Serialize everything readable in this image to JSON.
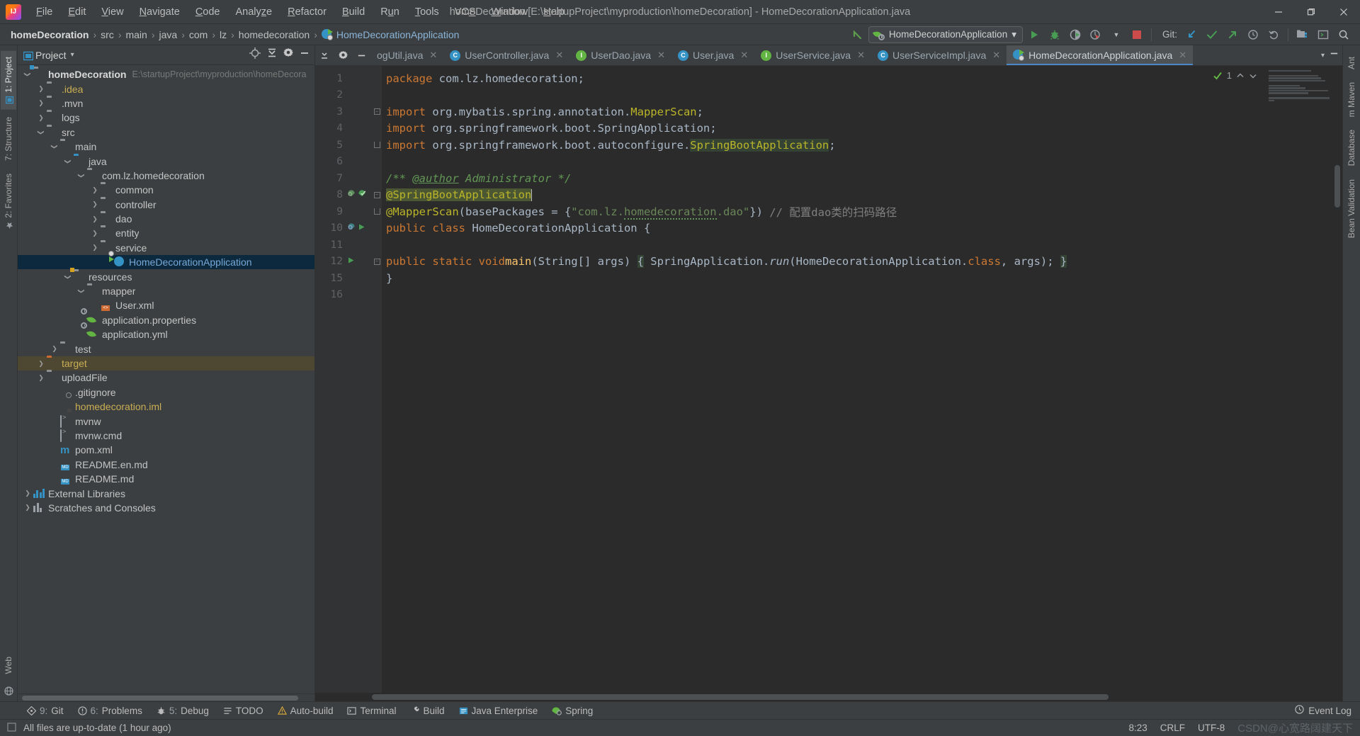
{
  "window": {
    "title": "homeDecoration [E:\\startupProject\\myproduction\\homeDecoration] - HomeDecorationApplication.java",
    "minimize": "─",
    "maximize": "❐",
    "close": "✕"
  },
  "menubar": {
    "items": [
      "File",
      "Edit",
      "View",
      "Navigate",
      "Code",
      "Analyze",
      "Refactor",
      "Build",
      "Run",
      "Tools",
      "VCS",
      "Window",
      "Help"
    ]
  },
  "navbar": {
    "breadcrumbs": [
      "homeDecoration",
      "src",
      "main",
      "java",
      "com",
      "lz",
      "homedecoration"
    ],
    "current_file": "HomeDecorationApplication",
    "separator": "›",
    "run_config": "HomeDecorationApplication",
    "run_config_caret": "▾",
    "git_label": "Git:",
    "icons": [
      "back-arrow-icon",
      "run-icon",
      "debug-icon",
      "run-with-coverage-icon",
      "profiler-icon",
      "stop-icon",
      "git-update-icon",
      "git-commit-icon",
      "git-push-icon",
      "git-history-icon",
      "git-rollback-icon",
      "project-structure-icon",
      "terminal-icon",
      "search-everywhere-icon"
    ]
  },
  "project_panel": {
    "title": "Project",
    "title_caret": "▾",
    "actions": [
      "locate-icon",
      "collapse-all-icon",
      "settings-icon",
      "hide-icon"
    ],
    "tree": [
      {
        "label": "homeDecoration",
        "sub": "E:\\startupProject\\myproduction\\homeDecora",
        "depth": 0,
        "arrow": "v",
        "icon": "project-folder-icon",
        "style": "bold",
        "state": "normal"
      },
      {
        "label": ".idea",
        "sub": "",
        "depth": 1,
        "arrow": ">",
        "icon": "folder-icon",
        "style": "yellow",
        "state": "normal"
      },
      {
        "label": ".mvn",
        "sub": "",
        "depth": 1,
        "arrow": ">",
        "icon": "folder-icon",
        "style": "white",
        "state": "normal"
      },
      {
        "label": "logs",
        "sub": "",
        "depth": 1,
        "arrow": ">",
        "icon": "folder-icon",
        "style": "white",
        "state": "normal"
      },
      {
        "label": "src",
        "sub": "",
        "depth": 1,
        "arrow": "v",
        "icon": "folder-icon",
        "style": "white",
        "state": "normal"
      },
      {
        "label": "main",
        "sub": "",
        "depth": 2,
        "arrow": "v",
        "icon": "folder-icon",
        "style": "white",
        "state": "normal"
      },
      {
        "label": "java",
        "sub": "",
        "depth": 3,
        "arrow": "v",
        "icon": "source-folder-icon",
        "style": "white",
        "state": "normal"
      },
      {
        "label": "com.lz.homedecoration",
        "sub": "",
        "depth": 4,
        "arrow": "v",
        "icon": "package-icon",
        "style": "white",
        "state": "normal"
      },
      {
        "label": "common",
        "sub": "",
        "depth": 5,
        "arrow": ">",
        "icon": "package-icon",
        "style": "white",
        "state": "normal"
      },
      {
        "label": "controller",
        "sub": "",
        "depth": 5,
        "arrow": ">",
        "icon": "package-icon",
        "style": "white",
        "state": "normal"
      },
      {
        "label": "dao",
        "sub": "",
        "depth": 5,
        "arrow": ">",
        "icon": "package-icon",
        "style": "white",
        "state": "normal"
      },
      {
        "label": "entity",
        "sub": "",
        "depth": 5,
        "arrow": ">",
        "icon": "package-icon",
        "style": "white",
        "state": "normal"
      },
      {
        "label": "service",
        "sub": "",
        "depth": 5,
        "arrow": ">",
        "icon": "package-icon",
        "style": "white",
        "state": "normal"
      },
      {
        "label": "HomeDecorationApplication",
        "sub": "",
        "depth": 6,
        "arrow": "",
        "icon": "spring-boot-class-icon",
        "style": "blue",
        "state": "selected"
      },
      {
        "label": "resources",
        "sub": "",
        "depth": 3,
        "arrow": "v",
        "icon": "resources-folder-icon",
        "style": "white",
        "state": "normal"
      },
      {
        "label": "mapper",
        "sub": "",
        "depth": 4,
        "arrow": "v",
        "icon": "folder-icon",
        "style": "white",
        "state": "normal"
      },
      {
        "label": "User.xml",
        "sub": "",
        "depth": 5,
        "arrow": "",
        "icon": "xml-file-icon",
        "style": "white",
        "state": "normal"
      },
      {
        "label": "application.properties",
        "sub": "",
        "depth": 4,
        "arrow": "",
        "icon": "spring-config-icon",
        "style": "white",
        "state": "normal"
      },
      {
        "label": "application.yml",
        "sub": "",
        "depth": 4,
        "arrow": "",
        "icon": "spring-config-icon",
        "style": "white",
        "state": "normal"
      },
      {
        "label": "test",
        "sub": "",
        "depth": 2,
        "arrow": ">",
        "icon": "folder-icon",
        "style": "white",
        "state": "normal"
      },
      {
        "label": "target",
        "sub": "",
        "depth": 1,
        "arrow": ">",
        "icon": "excluded-folder-icon",
        "style": "yellow",
        "state": "highlighted"
      },
      {
        "label": "uploadFile",
        "sub": "",
        "depth": 1,
        "arrow": ">",
        "icon": "folder-icon",
        "style": "white",
        "state": "normal"
      },
      {
        "label": ".gitignore",
        "sub": "",
        "depth": 2,
        "arrow": "",
        "icon": "gitignore-file-icon",
        "style": "white",
        "state": "normal"
      },
      {
        "label": "homedecoration.iml",
        "sub": "",
        "depth": 2,
        "arrow": "",
        "icon": "iml-file-icon",
        "style": "yellow",
        "state": "normal"
      },
      {
        "label": "mvnw",
        "sub": "",
        "depth": 2,
        "arrow": "",
        "icon": "shell-file-icon",
        "style": "white",
        "state": "normal"
      },
      {
        "label": "mvnw.cmd",
        "sub": "",
        "depth": 2,
        "arrow": "",
        "icon": "cmd-file-icon",
        "style": "white",
        "state": "normal"
      },
      {
        "label": "pom.xml",
        "sub": "",
        "depth": 2,
        "arrow": "",
        "icon": "maven-pom-icon",
        "style": "white",
        "state": "normal"
      },
      {
        "label": "README.en.md",
        "sub": "",
        "depth": 2,
        "arrow": "",
        "icon": "markdown-file-icon",
        "style": "white",
        "state": "normal"
      },
      {
        "label": "README.md",
        "sub": "",
        "depth": 2,
        "arrow": "",
        "icon": "markdown-file-icon",
        "style": "white",
        "state": "normal"
      },
      {
        "label": "External Libraries",
        "sub": "",
        "depth": 0,
        "arrow": ">",
        "icon": "external-libraries-icon",
        "style": "white",
        "state": "normal"
      },
      {
        "label": "Scratches and Consoles",
        "sub": "",
        "depth": 0,
        "arrow": ">",
        "icon": "scratches-icon",
        "style": "white",
        "state": "normal"
      }
    ]
  },
  "left_strip": {
    "tabs": [
      {
        "label": "1: Project",
        "selected": true
      },
      {
        "label": "7: Structure",
        "selected": false
      },
      {
        "label": "2: Favorites",
        "selected": false
      },
      {
        "label": "Web",
        "selected": false
      }
    ]
  },
  "right_strip": {
    "tabs": [
      {
        "label": "Ant",
        "selected": false
      },
      {
        "label": "m Maven",
        "selected": false
      },
      {
        "label": "Database",
        "selected": false
      },
      {
        "label": "Bean Validation",
        "selected": false
      }
    ]
  },
  "editor": {
    "tabs": [
      {
        "label": "ogUtil.java",
        "icon": "",
        "active": false,
        "closable": true,
        "clipped": true
      },
      {
        "label": "UserController.java",
        "icon": "class-icon",
        "active": false,
        "closable": true,
        "clipped": false
      },
      {
        "label": "UserDao.java",
        "icon": "interface-icon",
        "active": false,
        "closable": true,
        "clipped": false
      },
      {
        "label": "User.java",
        "icon": "class-icon",
        "active": false,
        "closable": true,
        "clipped": false
      },
      {
        "label": "UserService.java",
        "icon": "interface-icon",
        "active": false,
        "closable": true,
        "clipped": false
      },
      {
        "label": "UserServiceImpl.java",
        "icon": "class-icon",
        "active": false,
        "closable": true,
        "clipped": false
      },
      {
        "label": "HomeDecorationApplication.java",
        "icon": "spring-boot-class-icon",
        "active": true,
        "closable": true,
        "clipped": false
      }
    ],
    "tab_close_glyph": "✕",
    "line_numbers": [
      "1",
      "2",
      "3",
      "4",
      "5",
      "6",
      "7",
      "8",
      "9",
      "10",
      "11",
      "12",
      "15",
      "16"
    ],
    "warning_count": "1",
    "warning_icon": "inspection-ok-icon",
    "lines": [
      {
        "n": "1",
        "html": "<span class=\"kw\">package</span> com.lz.homedecoration;"
      },
      {
        "n": "2",
        "html": ""
      },
      {
        "n": "3",
        "html": "<span class=\"kw\">import</span> org.mybatis.spring.annotation.<span class=\"ann\">MapperScan</span>;"
      },
      {
        "n": "4",
        "html": "<span class=\"kw\">import</span> org.springframework.boot.SpringApplication;"
      },
      {
        "n": "5",
        "html": "<span class=\"kw\">import</span> org.springframework.boot.autoconfigure.<span class=\"hl-green ann\">SpringBootApplication</span>;"
      },
      {
        "n": "6",
        "html": ""
      },
      {
        "n": "7",
        "html": "<span class=\"doc ital\">/** </span><span class=\"doctag\">@author</span><span class=\"doc ital\"> Administrator */</span>"
      },
      {
        "n": "8",
        "html": "<span class=\"hl-sel ann\">@SpringBootApplication</span><span class=\"caret\"></span>"
      },
      {
        "n": "9",
        "html": "<span class=\"ann\">@MapperScan</span>(basePackages = {<span class=\"str\">\"com.lz.<span class=\"squig\">homedecoration</span>.dao\"</span>}) <span class=\"cmt\">// 配置dao类的扫码路径</span>"
      },
      {
        "n": "10",
        "html": "<span class=\"kw\">public class</span> HomeDecorationApplication {"
      },
      {
        "n": "11",
        "html": ""
      },
      {
        "n": "12",
        "html": "  <span class=\"kw\">public static void</span> <span class=\"fn\">main</span>(String[] args) <span class=\"hl-green\">{</span> SpringApplication.<span class=\"ital\">run</span>(HomeDecorationApplication.<span class=\"kw\">class</span>, args); <span class=\"hl-green\">}</span>"
      },
      {
        "n": "15",
        "html": "}"
      },
      {
        "n": "16",
        "html": ""
      }
    ]
  },
  "tool_windows": {
    "items": [
      {
        "key": "9:",
        "label": "Git",
        "icon": "git-icon"
      },
      {
        "key": "6:",
        "label": "Problems",
        "icon": "problems-icon"
      },
      {
        "key": "5:",
        "label": "Debug",
        "icon": "debug-icon"
      },
      {
        "key": "",
        "label": "TODO",
        "icon": "todo-icon"
      },
      {
        "key": "",
        "label": "Auto-build",
        "icon": "auto-build-icon"
      },
      {
        "key": "",
        "label": "Terminal",
        "icon": "terminal-icon"
      },
      {
        "key": "",
        "label": "Build",
        "icon": "build-icon"
      },
      {
        "key": "",
        "label": "Java Enterprise",
        "icon": "java-enterprise-icon"
      },
      {
        "key": "",
        "label": "Spring",
        "icon": "spring-icon"
      }
    ],
    "event_log": "Event Log",
    "event_log_icon": "event-log-icon"
  },
  "statusbar": {
    "message": "All files are up-to-date (1 hour ago)",
    "message_icon": "checkmark-icon",
    "caret_position": "8:23",
    "line_separator": "CRLF",
    "encoding": "UTF-8",
    "watermark": "CSDN@心宽路阔建天下"
  },
  "colors": {
    "accent_blue": "#3592c4",
    "selection_blue": "#0d293e",
    "highlight_brown": "#4e4833",
    "green": "#62b543",
    "orange": "#cf6a32",
    "annotation_yellow": "#bbb529",
    "keyword_orange": "#cc7832",
    "string_green": "#6a8759",
    "comment_gray": "#808080"
  }
}
